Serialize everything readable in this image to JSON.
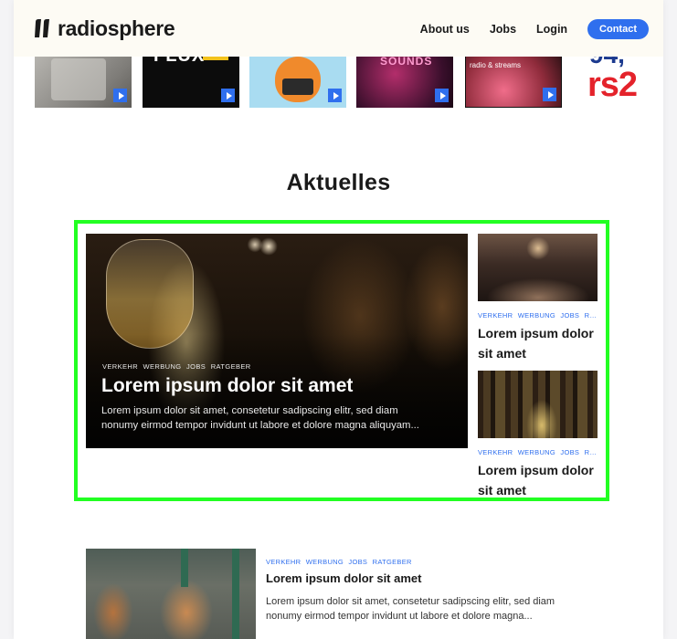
{
  "header": {
    "logo_text": "radiosphere",
    "nav": [
      "About us",
      "Jobs",
      "Login"
    ],
    "contact_label": "Contact"
  },
  "stations": {
    "flux_text": "FLUX",
    "sounds_text": "SOUNDS",
    "streams_text": "radio & streams",
    "rs2_top": "94,",
    "rs2_bottom": "rs2"
  },
  "section": {
    "title": "Aktuelles"
  },
  "featured": {
    "tags": [
      "VERKEHR",
      "WERBUNG",
      "JOBS",
      "RATGEBER"
    ],
    "title": "Lorem ipsum dolor sit amet",
    "excerpt_line1": "Lorem ipsum dolor sit amet, consetetur sadipscing elitr, sed diam",
    "excerpt_line2": "nonumy eirmod tempor invidunt ut labore et dolore magna aliquyam..."
  },
  "side_cards": [
    {
      "tags": [
        "VERKEHR",
        "WERBUNG",
        "JOBS",
        "R..."
      ],
      "title": "Lorem ipsum dolor sit amet"
    },
    {
      "tags": [
        "VERKEHR",
        "WERBUNG",
        "JOBS",
        "R..."
      ],
      "title": "Lorem ipsum dolor sit amet"
    }
  ],
  "list_item": {
    "tags": [
      "VERKEHR",
      "WERBUNG",
      "JOBS",
      "RATGEBER"
    ],
    "title": "Lorem ipsum dolor sit amet",
    "excerpt_line1": "Lorem ipsum dolor sit amet, consetetur sadipscing elitr, sed diam",
    "excerpt_line2": "nonumy eirmod tempor invidunt ut labore et dolore magna..."
  },
  "colors": {
    "accent": "#2f6fee",
    "highlight_frame": "#22ff22",
    "header_bg": "#fdfbf4"
  }
}
